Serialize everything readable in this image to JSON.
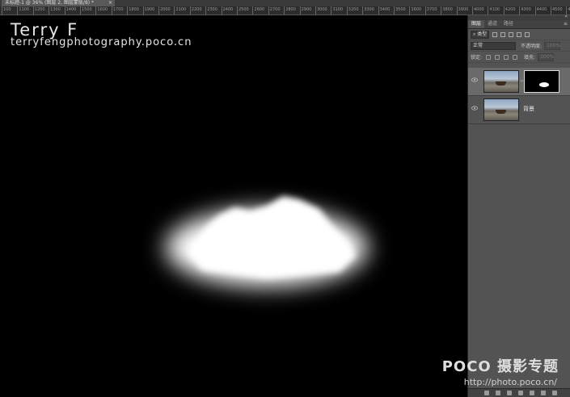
{
  "document": {
    "tab_label": "未标题-1 @ 36% (图层 2, 图层蒙版/8) *",
    "close": "×"
  },
  "ruler": {
    "labels": [
      "100",
      "1100",
      "1200",
      "1300",
      "1400",
      "1500",
      "1600",
      "1700",
      "1800",
      "1900",
      "2000",
      "2100",
      "2200",
      "2300",
      "2400",
      "2500",
      "2600",
      "2700",
      "2800",
      "2900",
      "3000",
      "3100",
      "3200",
      "3300",
      "3400",
      "3500",
      "3600",
      "3700",
      "3800",
      "3900",
      "4000",
      "4100",
      "4200",
      "4300",
      "4400",
      "4500",
      "4600"
    ]
  },
  "canvas": {
    "watermark_name": "Terry  F",
    "watermark_site": "terryfengphotography.poco.cn"
  },
  "layers_panel": {
    "tabs": [
      {
        "label": "图层",
        "active": true
      },
      {
        "label": "通道",
        "active": false
      },
      {
        "label": "路径",
        "active": false
      }
    ],
    "filter_kind": "类型",
    "blend_mode": "正常",
    "opacity_label": "不透明度:",
    "opacity_value": "100%",
    "lock_label": "锁定:",
    "fill_label": "填充:",
    "fill_value": "100%",
    "layers": [
      {
        "name": "",
        "has_mask": true,
        "selected": true,
        "visible": true
      },
      {
        "name": "背景",
        "has_mask": false,
        "selected": false,
        "visible": true,
        "locked": true
      }
    ]
  },
  "overlay": {
    "poco_logo": "POCO 摄影专题",
    "poco_url": "http://photo.poco.cn/"
  }
}
